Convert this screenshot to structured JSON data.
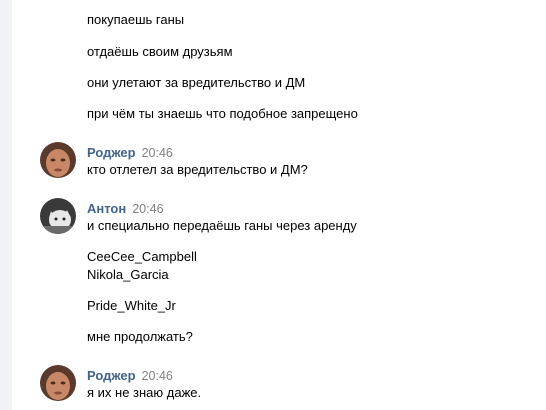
{
  "messages_top": [
    "покупаешь ганы",
    "отдаёшь своим друзьям",
    "они улетают за вредительство и ДМ",
    "при чём ты знаешь что подобное запрещено"
  ],
  "block1": {
    "author": "Роджер",
    "time": "20:46",
    "lines": [
      "кто отлетел за вредительство и ДМ?"
    ]
  },
  "block2": {
    "author": "Антон",
    "time": "20:46",
    "lines": [
      "и специально передаёшь ганы через аренду",
      "CeeCee_Campbell",
      "Nikola_Garcia",
      "Pride_White_Jr",
      "мне продолжать?"
    ]
  },
  "block3": {
    "author": "Роджер",
    "time": "20:46",
    "lines": [
      "я их не знаю даже."
    ]
  }
}
